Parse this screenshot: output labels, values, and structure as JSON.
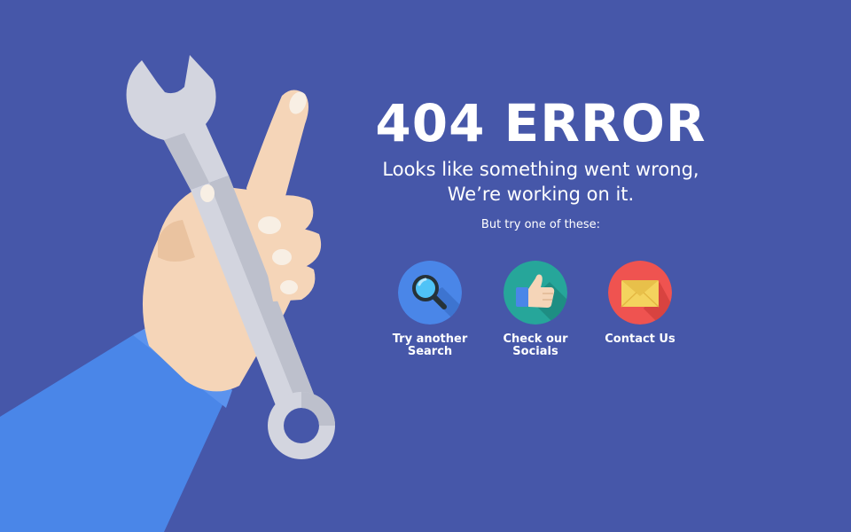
{
  "error": {
    "title": "404 ERROR",
    "message_line1": "Looks like something went wrong,",
    "message_line2": "We’re working on it.",
    "try_text": "But try one of these:"
  },
  "options": [
    {
      "label_line1": "Try another",
      "label_line2": "Search",
      "icon": "magnifier-icon",
      "color": "#4A86E8"
    },
    {
      "label_line1": "Check our",
      "label_line2": "Socials",
      "icon": "thumbs-up-icon",
      "color": "#26A69A"
    },
    {
      "label_line1": "Contact Us",
      "label_line2": "",
      "icon": "envelope-icon",
      "color": "#EF5350"
    }
  ],
  "colors": {
    "background": "#4657A9",
    "sleeve": "#4A86E8",
    "skin": "#F5D5B8",
    "wrench": "#D3D5DF"
  }
}
